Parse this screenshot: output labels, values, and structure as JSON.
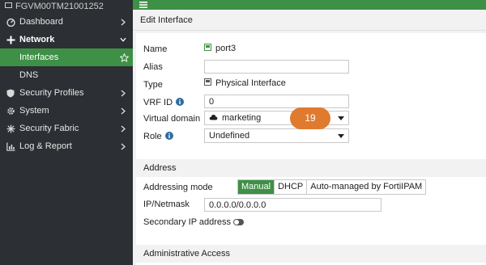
{
  "device": {
    "name": "FGVM00TM21001252"
  },
  "sidebar": {
    "items": [
      {
        "label": "Dashboard",
        "icon": "dashboard-icon"
      },
      {
        "label": "Network",
        "icon": "network-icon"
      },
      {
        "label": "Interfaces"
      },
      {
        "label": "DNS"
      },
      {
        "label": "Security Profiles",
        "icon": "shield-icon"
      },
      {
        "label": "System",
        "icon": "gear-icon"
      },
      {
        "label": "Security Fabric",
        "icon": "fabric-icon"
      },
      {
        "label": "Log & Report",
        "icon": "chart-icon"
      }
    ]
  },
  "page": {
    "title": "Edit Interface"
  },
  "form": {
    "name_label": "Name",
    "name_value": "port3",
    "alias_label": "Alias",
    "alias_value": "",
    "type_label": "Type",
    "type_value": "Physical Interface",
    "vrf_label": "VRF ID",
    "vrf_value": "0",
    "vdom_label": "Virtual domain",
    "vdom_value": "marketing",
    "role_label": "Role",
    "role_value": "Undefined"
  },
  "step_badge": "19",
  "address": {
    "section_title": "Address",
    "mode_label": "Addressing mode",
    "modes": [
      "Manual",
      "DHCP",
      "Auto-managed by FortiIPAM"
    ],
    "selected_mode": "Manual",
    "ipmask_label": "IP/Netmask",
    "ipmask_value": "0.0.0.0/0.0.0.0",
    "secondary_label": "Secondary IP address"
  },
  "admin_access": {
    "section_title": "Administrative Access"
  },
  "colors": {
    "accent": "#3e9046",
    "sidebar": "#2c2f33",
    "badge": "#e07a2e"
  }
}
